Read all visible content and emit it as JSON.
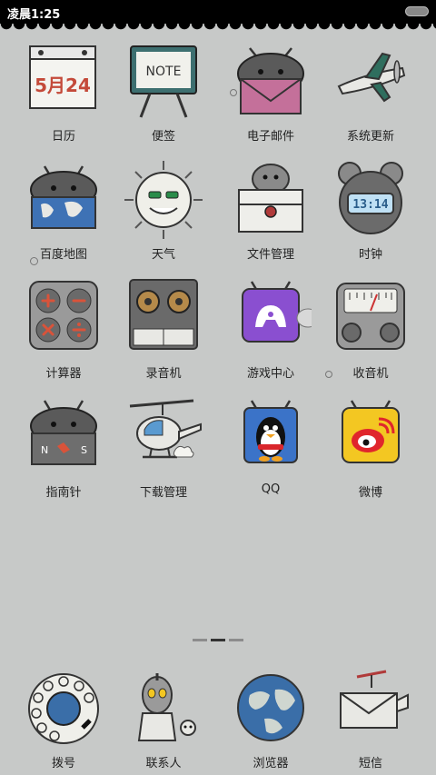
{
  "status_bar": {
    "time": "凌晨1:25"
  },
  "apps": [
    {
      "label": "日历",
      "icon": "calendar-icon",
      "date_text": "5月24"
    },
    {
      "label": "便签",
      "icon": "notes-icon",
      "board_text": "NOTE"
    },
    {
      "label": "电子邮件",
      "icon": "email-icon"
    },
    {
      "label": "系统更新",
      "icon": "airplane-update-icon"
    },
    {
      "label": "百度地图",
      "icon": "map-icon"
    },
    {
      "label": "天气",
      "icon": "sun-weather-icon"
    },
    {
      "label": "文件管理",
      "icon": "file-manager-icon"
    },
    {
      "label": "时钟",
      "icon": "clock-icon",
      "clock_text": "13:14"
    },
    {
      "label": "计算器",
      "icon": "calculator-icon"
    },
    {
      "label": "录音机",
      "icon": "recorder-icon"
    },
    {
      "label": "游戏中心",
      "icon": "game-center-icon"
    },
    {
      "label": "收音机",
      "icon": "radio-icon"
    },
    {
      "label": "指南针",
      "icon": "compass-icon",
      "compass_n": "N",
      "compass_s": "S"
    },
    {
      "label": "下载管理",
      "icon": "helicopter-download-icon"
    },
    {
      "label": "QQ",
      "icon": "qq-penguin-icon"
    },
    {
      "label": "微博",
      "icon": "weibo-icon"
    }
  ],
  "page_indicator": {
    "pages": 3,
    "current": 2
  },
  "dock": [
    {
      "label": "拨号",
      "icon": "rotary-dial-icon"
    },
    {
      "label": "联系人",
      "icon": "contacts-robot-icon"
    },
    {
      "label": "浏览器",
      "icon": "globe-browser-icon"
    },
    {
      "label": "短信",
      "icon": "messages-plane-icon"
    }
  ],
  "colors": {
    "wallpaper": "#c7c9c8",
    "status_bar": "#000000",
    "game_center": "#8a4fd0",
    "email": "#c4709a",
    "qq_background": "#3b73c8",
    "weibo_background": "#f3c722",
    "weibo_red": "#e0262c"
  }
}
